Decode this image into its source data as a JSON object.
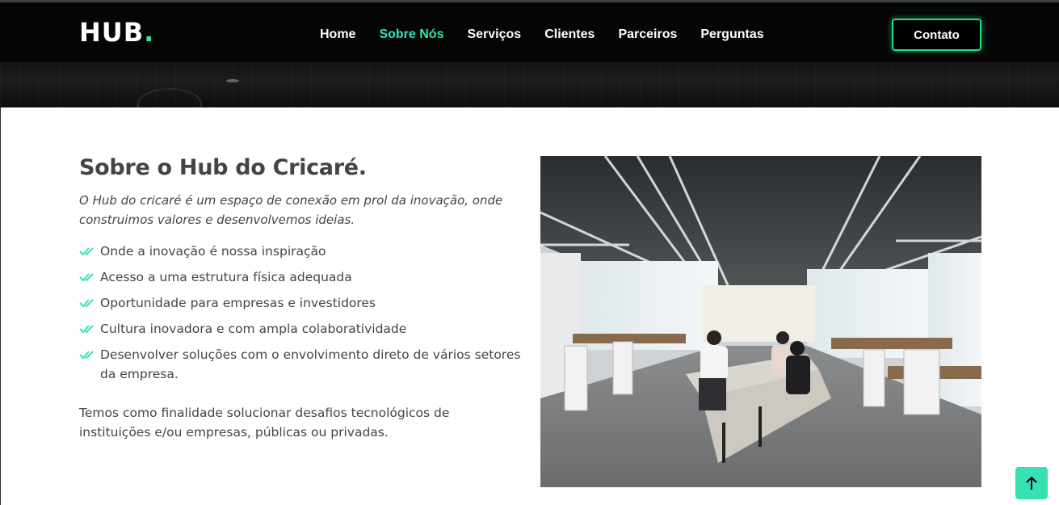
{
  "brand": {
    "logo_text": "HUB",
    "logo_dot": ".",
    "accent": "#38e0b5",
    "button_glow": "#22e07a"
  },
  "nav": {
    "items": [
      {
        "label": "Home",
        "active": false
      },
      {
        "label": "Sobre Nós",
        "active": true
      },
      {
        "label": "Serviços",
        "active": false
      },
      {
        "label": "Clientes",
        "active": false
      },
      {
        "label": "Parceiros",
        "active": false
      },
      {
        "label": "Perguntas",
        "active": false
      }
    ],
    "contact_label": "Contato"
  },
  "about": {
    "title": "Sobre o Hub do Cricaré.",
    "lead": "O Hub do cricaré é um espaço de conexão em prol da inovação, onde construimos valores e desenvolvemos ideias.",
    "points": [
      "Onde a inovação é nossa inspiração",
      "Acesso a uma estrutura física adequada",
      "Oportunidade para empresas e investidores",
      "Cultura inovadora e com ampla colaboratividade",
      "Desenvolver soluções com o envolvimento direto de vários setores da empresa."
    ],
    "closing": "Temos como finalidade solucionar desafios tecnológicos de instituições e/ou empresas, públicas ou privadas."
  },
  "icons": {
    "check": "double-check-icon",
    "scroll_top": "arrow-up-icon"
  }
}
